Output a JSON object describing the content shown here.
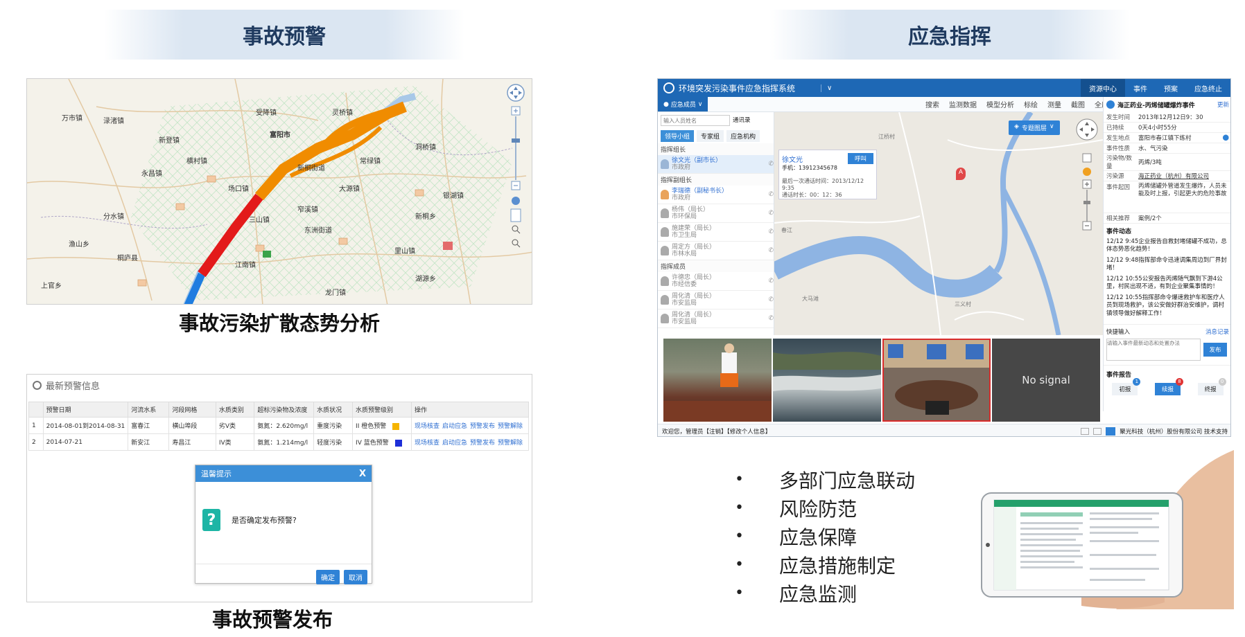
{
  "left": {
    "banner": "事故预警",
    "map": {
      "caption": "事故污染扩散态势分析",
      "labels": [
        "万市镇",
        "渌渚镇",
        "新登镇",
        "永昌镇",
        "场口镇",
        "富阳市",
        "桐庐县",
        "分水镇",
        "窄溪镇",
        "江南镇",
        "上官乡",
        "大源镇",
        "里山镇",
        "常绿镇",
        "新桐乡",
        "渔山乡",
        "灵桥镇",
        "龙门镇",
        "湖源乡",
        "洞桥镇",
        "万市镇",
        "横村镇",
        "胥口镇",
        "银湖镇",
        "受降镇",
        "东洲街道",
        "新桐街道",
        "三山镇"
      ]
    },
    "warning": {
      "caption": "事故预警发布",
      "title": "最新预警信息",
      "columns": [
        "",
        "预警日期",
        "河流水系",
        "河段网格",
        "水质类别",
        "超标污染物及浓度",
        "水质状况",
        "水质预警级别",
        "操作"
      ],
      "rows": [
        {
          "no": "1",
          "date": "2014-08-01到2014-08-31",
          "system": "富春江",
          "section": "横山埠段",
          "class": "劣V类",
          "pollutant": "氨氮：2.620mg/l",
          "status": "重度污染",
          "level": "II 橙色预警",
          "level_color": "#f5b400",
          "ops": [
            "现场核查",
            "启动应急",
            "预警发布",
            "预警解除"
          ]
        },
        {
          "no": "2",
          "date": "2014-07-21",
          "system": "新安江",
          "section": "寿昌江",
          "class": "IV类",
          "pollutant": "氨氮：1.214mg/l",
          "status": "轻度污染",
          "level": "IV 蓝色预警",
          "level_color": "#1e2fd8",
          "ops": [
            "现场核查",
            "启动应急",
            "预警发布",
            "预警解除"
          ]
        }
      ],
      "dialog": {
        "title": "温馨提示",
        "close": "X",
        "message": "是否确定发布预警?",
        "ok": "确定",
        "cancel": "取消"
      }
    }
  },
  "right": {
    "banner": "应急指挥",
    "system": {
      "title": "环境突发污染事件应急指挥系统",
      "nav": [
        "资源中心",
        "事件",
        "预案",
        "应急终止"
      ],
      "toolbar": [
        "搜索",
        "监测数据",
        "模型分析",
        "标绘",
        "测量",
        "截图",
        "全屏"
      ],
      "left_panel": {
        "tab": "应急成员",
        "search_placeholder": "输入人员姓名",
        "address_book": "通讯录",
        "groups": [
          "领导小组",
          "专家组",
          "应急机构"
        ],
        "sections": [
          {
            "title": "指挥组长",
            "members": [
              {
                "name": "徐文光（副市长）",
                "org": "市政府"
              }
            ]
          },
          {
            "title": "指挥副组长",
            "members": [
              {
                "name": "李瑞德（副秘书长）",
                "org": "市政府"
              },
              {
                "name": "杨伟（局长）",
                "org": "市环保局"
              },
              {
                "name": "施建荣（局长）",
                "org": "市卫生局"
              },
              {
                "name": "周定方（局长）",
                "org": "市林水局"
              }
            ]
          },
          {
            "title": "指挥成员",
            "members": [
              {
                "name": "许德忠（局长）",
                "org": "市经信委"
              },
              {
                "name": "周化清（局长）",
                "org": "市安监局"
              },
              {
                "name": "周化清（局长）",
                "org": "市安监局"
              }
            ]
          }
        ]
      },
      "popup": {
        "name": "徐文光",
        "phone": "手机：13912345678",
        "call": "呼叫",
        "last_call": "最后一次通话时间：2013/12/12 9:35",
        "duration": "通话时长：00：12：36"
      },
      "map_layer_btn": "专题图层",
      "map_labels": [
        "江桥村",
        "春江",
        "大马滩",
        "三义村"
      ],
      "marker": "A",
      "no_signal": "No signal",
      "event": {
        "title": "海正药业-丙烯储罐爆炸事件",
        "edit": "更新",
        "fields": [
          {
            "k": "发生时间",
            "v": "2013年12月12日9：30"
          },
          {
            "k": "已持续",
            "v": "0天4小时55分"
          },
          {
            "k": "发生地点",
            "v": "富阳市春江镇下练村"
          },
          {
            "k": "事件性质",
            "v": "水、气污染"
          },
          {
            "k": "污染物/数量",
            "v": "丙烯/3吨"
          },
          {
            "k": "污染源",
            "v": "海正药业（杭州）有限公司"
          },
          {
            "k": "事件起因",
            "v": "丙烯储罐外管道发生爆炸，人员未能及时上报，引起更大的危险事故"
          },
          {
            "k": "相关推荐",
            "v": "案例/2个"
          }
        ],
        "dynamics_title": "事件动态",
        "dynamics": [
          "12/12 9:45企业报告自救封堵储罐不成功，总体态势恶化趋势！",
          "12/12 9:48指挥部命令迅速调集周边到厂界封堵！",
          "12/12 10:55公安报告丙烯随气飘到下游4公里，村民出现不适，有到企业聚集事情的！",
          "12/12 10:55指挥部命令爆速救护车和医疗人员到现场救护，该公安做好群治安维护，调村镇领导做好解释工作！"
        ],
        "quick_input": "快捷输入",
        "msg_record": "消息记录",
        "input_placeholder": "请输入事件最新动态和处置办法",
        "publish": "发布",
        "report_title": "事件报告",
        "reports": [
          {
            "label": "初报",
            "count": "1"
          },
          {
            "label": "续报",
            "count": "8"
          },
          {
            "label": "终报",
            "count": "0"
          }
        ]
      },
      "footer_left": "欢迎您，管理员【注销】【修改个人信息】",
      "footer_right": "聚光科技（杭州）股份有限公司 技术支持"
    },
    "bullets": [
      "多部门应急联动",
      "风险防范",
      "应急保障",
      "应急措施制定",
      "应急监测"
    ]
  }
}
